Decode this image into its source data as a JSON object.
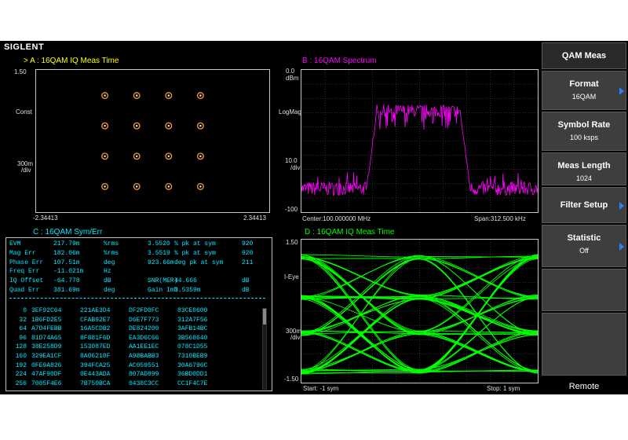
{
  "app": {
    "brand": "SIGLENT"
  },
  "windows": {
    "a": {
      "marker": ">",
      "title": "A :  16QAM  IQ Meas Time",
      "ytop": "1.50",
      "ylabel": "Const",
      "yscale": "300m",
      "yunit": "/div",
      "xmin": "-2.34413",
      "xmax": "2.34413"
    },
    "b": {
      "title": "B :  16QAM  Spectrum",
      "ytop": "0.0",
      "yunit_top": "dBm",
      "ylabel": "LogMag",
      "yscale": "10.0",
      "yunit": "/div",
      "ybottom": "-100",
      "center": "Center:100.000000 MHz",
      "span": "Span:312.500 kHz"
    },
    "c": {
      "title": "C :  16QAM  Sym/Err"
    },
    "d": {
      "title": "D :  16QAM  IQ Meas Time",
      "ytop": "1.50",
      "ylabel": "I-Eye",
      "yscale": "300m",
      "yunit": "/div",
      "ybottom": "-1.50",
      "start": "Start: -1 sym",
      "stop": "Stop: 1 sym"
    }
  },
  "colors": {
    "a_title": "#ffff00",
    "b_title": "#ff00ff",
    "c_title": "#00e8ff",
    "d_title": "#00ff00",
    "trace_b": "#ff00ff",
    "trace_d": "#00ff00",
    "const_dot": "#ff9b2e"
  },
  "measurements": [
    {
      "name": "EVM",
      "value": "217.79m",
      "unit": "%rms",
      "value2": "3.5520",
      "label2": "% pk at sym",
      "value3": "920"
    },
    {
      "name": "Mag Err",
      "value": "182.06m",
      "unit": "%rms",
      "value2": "3.5519",
      "label2": "% pk at sym",
      "value3": "920"
    },
    {
      "name": "Phase Err",
      "value": "107.51m",
      "unit": "deg",
      "value2": "923.66m",
      "label2": "deg pk at sym",
      "value3": "211"
    },
    {
      "name": "Freq Err",
      "value": "-11.021m",
      "unit": "Hz",
      "value2": "",
      "label2": "",
      "value3": ""
    },
    {
      "name": "IQ Offset",
      "value": "-64.778",
      "unit": "dB",
      "value2": "SNR(MER)",
      "label2": "44.666",
      "value3": "dB"
    },
    {
      "name": "Quad Err",
      "value": "381.69m",
      "unit": "deg",
      "value2": "Gain Imb",
      "label2": "3.5359m",
      "value3": "dB"
    }
  ],
  "symbols": [
    {
      "idx": "0",
      "c1": "3EF92C64",
      "c2": "221AE3D4",
      "c3": "DF2FD0FC",
      "c4": "83CE0600"
    },
    {
      "idx": "32",
      "c1": "1B6FD2E5",
      "c2": "CFAB92E7",
      "c3": "D6E7F773",
      "c4": "312A7F56"
    },
    {
      "idx": "64",
      "c1": "A7D4FEBB",
      "c2": "16A5CDB2",
      "c3": "DE824200",
      "c4": "3AFB14BC"
    },
    {
      "idx": "96",
      "c1": "81D74A65",
      "c2": "8F881F6D",
      "c3": "EA3D6C66",
      "c4": "3B568640"
    },
    {
      "idx": "128",
      "c1": "38E258D9",
      "c2": "153087ED",
      "c3": "AA1EE1EC",
      "c4": "078C1D55"
    },
    {
      "idx": "160",
      "c1": "329EA1CF",
      "c2": "8A06218F",
      "c3": "A98BABB3",
      "c4": "7310BEB9"
    },
    {
      "idx": "192",
      "c1": "0FE9A826",
      "c2": "394FCA25",
      "c3": "AC059551",
      "c4": "30A6796C"
    },
    {
      "idx": "224",
      "c1": "47AF90DF",
      "c2": "0E443ADA",
      "c3": "807AD899",
      "c4": "36BD0DD1"
    },
    {
      "idx": "256",
      "c1": "7085F4E6",
      "c2": "7B750BCA",
      "c3": "0438C3CC",
      "c4": "CC1F4C7E"
    }
  ],
  "softkeys": [
    {
      "title": "QAM Meas",
      "value": "",
      "arrow": false
    },
    {
      "title": "Format",
      "value": "16QAM",
      "arrow": true
    },
    {
      "title": "Symbol Rate",
      "value": "100 ksps",
      "arrow": false
    },
    {
      "title": "Meas Length",
      "value": "1024",
      "arrow": false
    },
    {
      "title": "Filter Setup",
      "value": "",
      "arrow": true
    },
    {
      "title": "Statistic",
      "value": "Off",
      "arrow": true
    },
    {
      "title": "",
      "value": "",
      "arrow": false
    },
    {
      "title": "",
      "value": "",
      "arrow": false
    }
  ],
  "remote_label": "Remote"
}
